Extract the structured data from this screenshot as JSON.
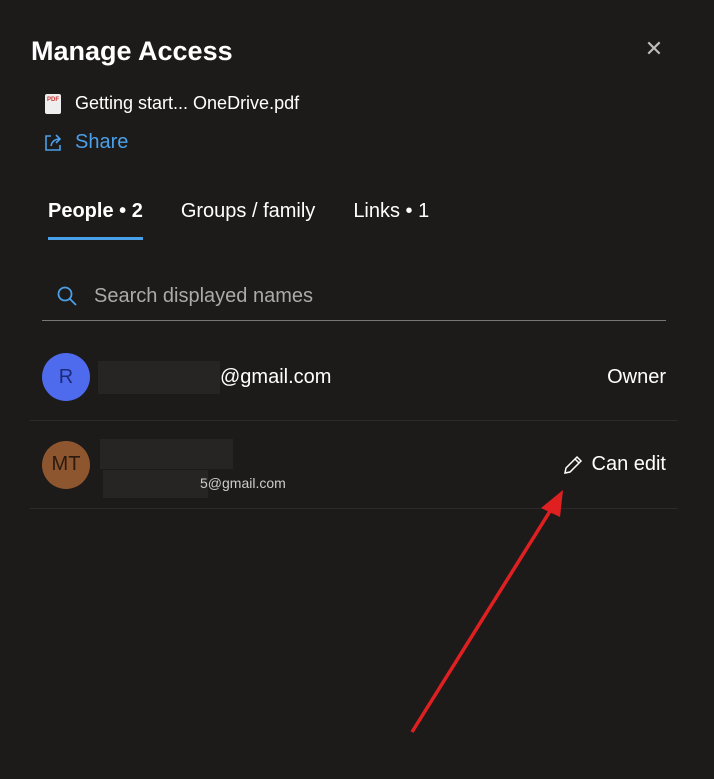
{
  "title": "Manage Access",
  "file_name": "Getting start... OneDrive.pdf",
  "share_label": "Share",
  "tabs": [
    {
      "label": "People • 2"
    },
    {
      "label": "Groups / family"
    },
    {
      "label": "Links • 1"
    }
  ],
  "search_placeholder": "Search displayed names",
  "people": [
    {
      "initials": "R",
      "email_suffix": "@gmail.com",
      "role": "Owner",
      "color": "#4f6bed"
    },
    {
      "initials": "MT",
      "email_suffix": "5@gmail.com",
      "role": "Can edit",
      "color": "#8e562e"
    }
  ],
  "annotation_color": "#e02020"
}
